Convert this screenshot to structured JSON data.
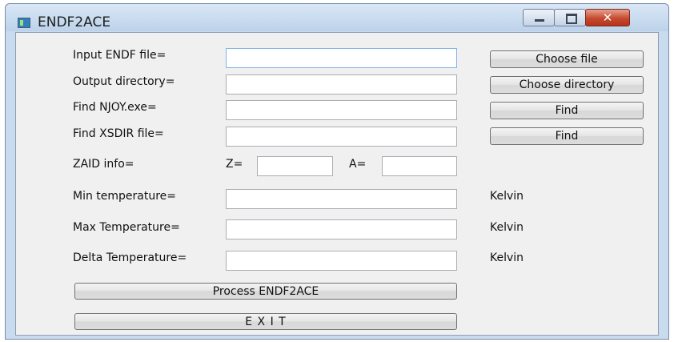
{
  "window": {
    "title": "ENDF2ACE"
  },
  "fields": {
    "input_endf": {
      "label": "Input ENDF file=",
      "value": ""
    },
    "output_dir": {
      "label": "Output directory=",
      "value": ""
    },
    "njoy": {
      "label": "Find NJOY.exe=",
      "value": ""
    },
    "xsdir": {
      "label": "Find XSDIR file=",
      "value": ""
    },
    "zaid": {
      "label": "ZAID info=",
      "z_label": "Z=",
      "z_value": "",
      "a_label": "A=",
      "a_value": ""
    },
    "min_temp": {
      "label": "Min temperature=",
      "value": "",
      "unit": "Kelvin"
    },
    "max_temp": {
      "label": "Max Temperature=",
      "value": "",
      "unit": "Kelvin"
    },
    "delta_temp": {
      "label": "Delta Temperature=",
      "value": "",
      "unit": "Kelvin"
    }
  },
  "buttons": {
    "choose_file": "Choose file",
    "choose_directory": "Choose directory",
    "find_njoy": "Find",
    "find_xsdir": "Find",
    "process": "Process ENDF2ACE",
    "exit": "E X I T"
  },
  "icons": {
    "app": "app-window-icon",
    "minimize": "minimize-icon",
    "maximize": "maximize-icon",
    "close": "close-icon"
  },
  "colors": {
    "close_button": "#c54a2f",
    "title_bar": "#c9dbef",
    "client_bg": "#f0f0f0"
  }
}
